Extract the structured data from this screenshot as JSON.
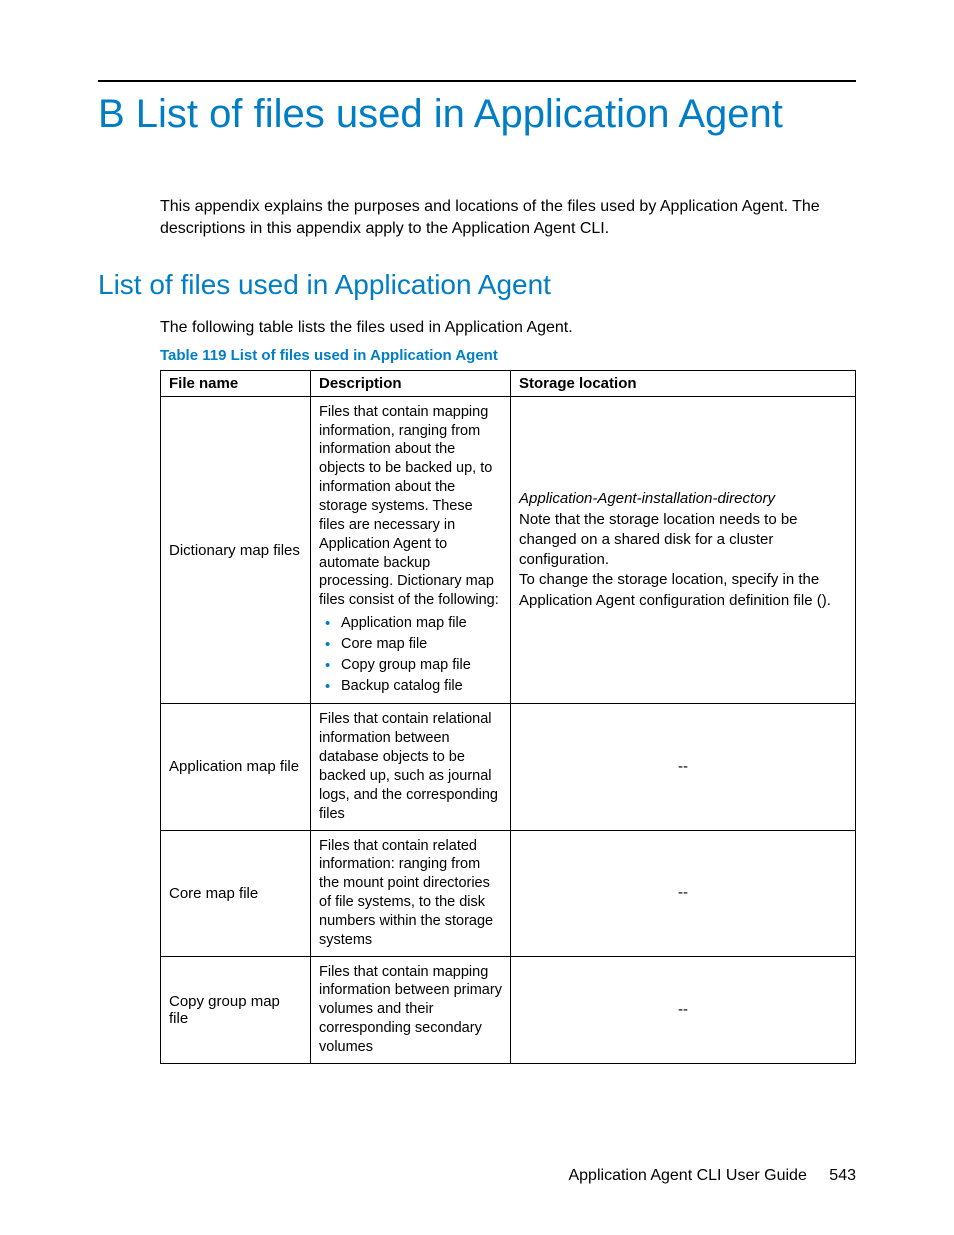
{
  "appendix": {
    "title": "B List of files used in Application Agent",
    "intro": "This appendix explains the purposes and locations of the files used by Application Agent. The descriptions in this appendix apply to the Application Agent CLI."
  },
  "section": {
    "title": "List of files used in Application Agent",
    "intro": "The following table lists the files used in Application Agent.",
    "table_caption": "Table 119 List of files used in Application Agent"
  },
  "table": {
    "headers": {
      "col1": "File name",
      "col2": "Description",
      "col3": "Storage location"
    },
    "row1": {
      "name": "Dictionary map files",
      "desc_main": "Files that contain mapping information, ranging from information about the objects to be backed up, to information about the storage systems. These files are necessary in Application Agent to automate backup processing. Dictionary map files consist of the following:",
      "bullets": {
        "b1": "Application map file",
        "b2": "Core map file",
        "b3": "Copy group map file",
        "b4": "Backup catalog file"
      },
      "loc_italic": "Application-Agent-installation-directory",
      "loc_l2": "Note that the storage location needs to be changed on a shared disk for a cluster configuration.",
      "loc_l3_a": "To change the storage location, specify ",
      "loc_l3_b": " in the Application Agent configuration definition file (",
      "loc_l3_c": ")."
    },
    "row2": {
      "name": "Application map file",
      "desc": "Files that contain relational information between database objects to be backed up, such as journal logs, and the corresponding files",
      "loc": "--"
    },
    "row3": {
      "name": "Core map file",
      "desc": "Files that contain related information: ranging from the mount point directories of file systems, to the disk numbers within the storage systems",
      "loc": "--"
    },
    "row4": {
      "name": "Copy group map file",
      "desc": "Files that contain mapping information between primary volumes and their corresponding secondary volumes",
      "loc": "--"
    }
  },
  "footer": {
    "doc": "Application Agent CLI User Guide",
    "page": "543"
  }
}
